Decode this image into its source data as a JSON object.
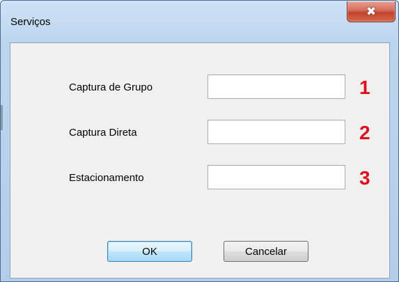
{
  "window": {
    "title": "Serviços",
    "close_glyph": "✖",
    "close_icon": "close-icon"
  },
  "fields": [
    {
      "label": "Captura de Grupo",
      "value": "",
      "number": "1"
    },
    {
      "label": "Captura Direta",
      "value": "",
      "number": "2"
    },
    {
      "label": "Estacionamento",
      "value": "",
      "number": "3"
    }
  ],
  "buttons": {
    "ok_label": "OK",
    "cancel_label": "Cancelar"
  },
  "colors": {
    "number_red": "#e0101a",
    "close_red": "#c1412d",
    "ok_border_blue": "#3c7fb1"
  }
}
